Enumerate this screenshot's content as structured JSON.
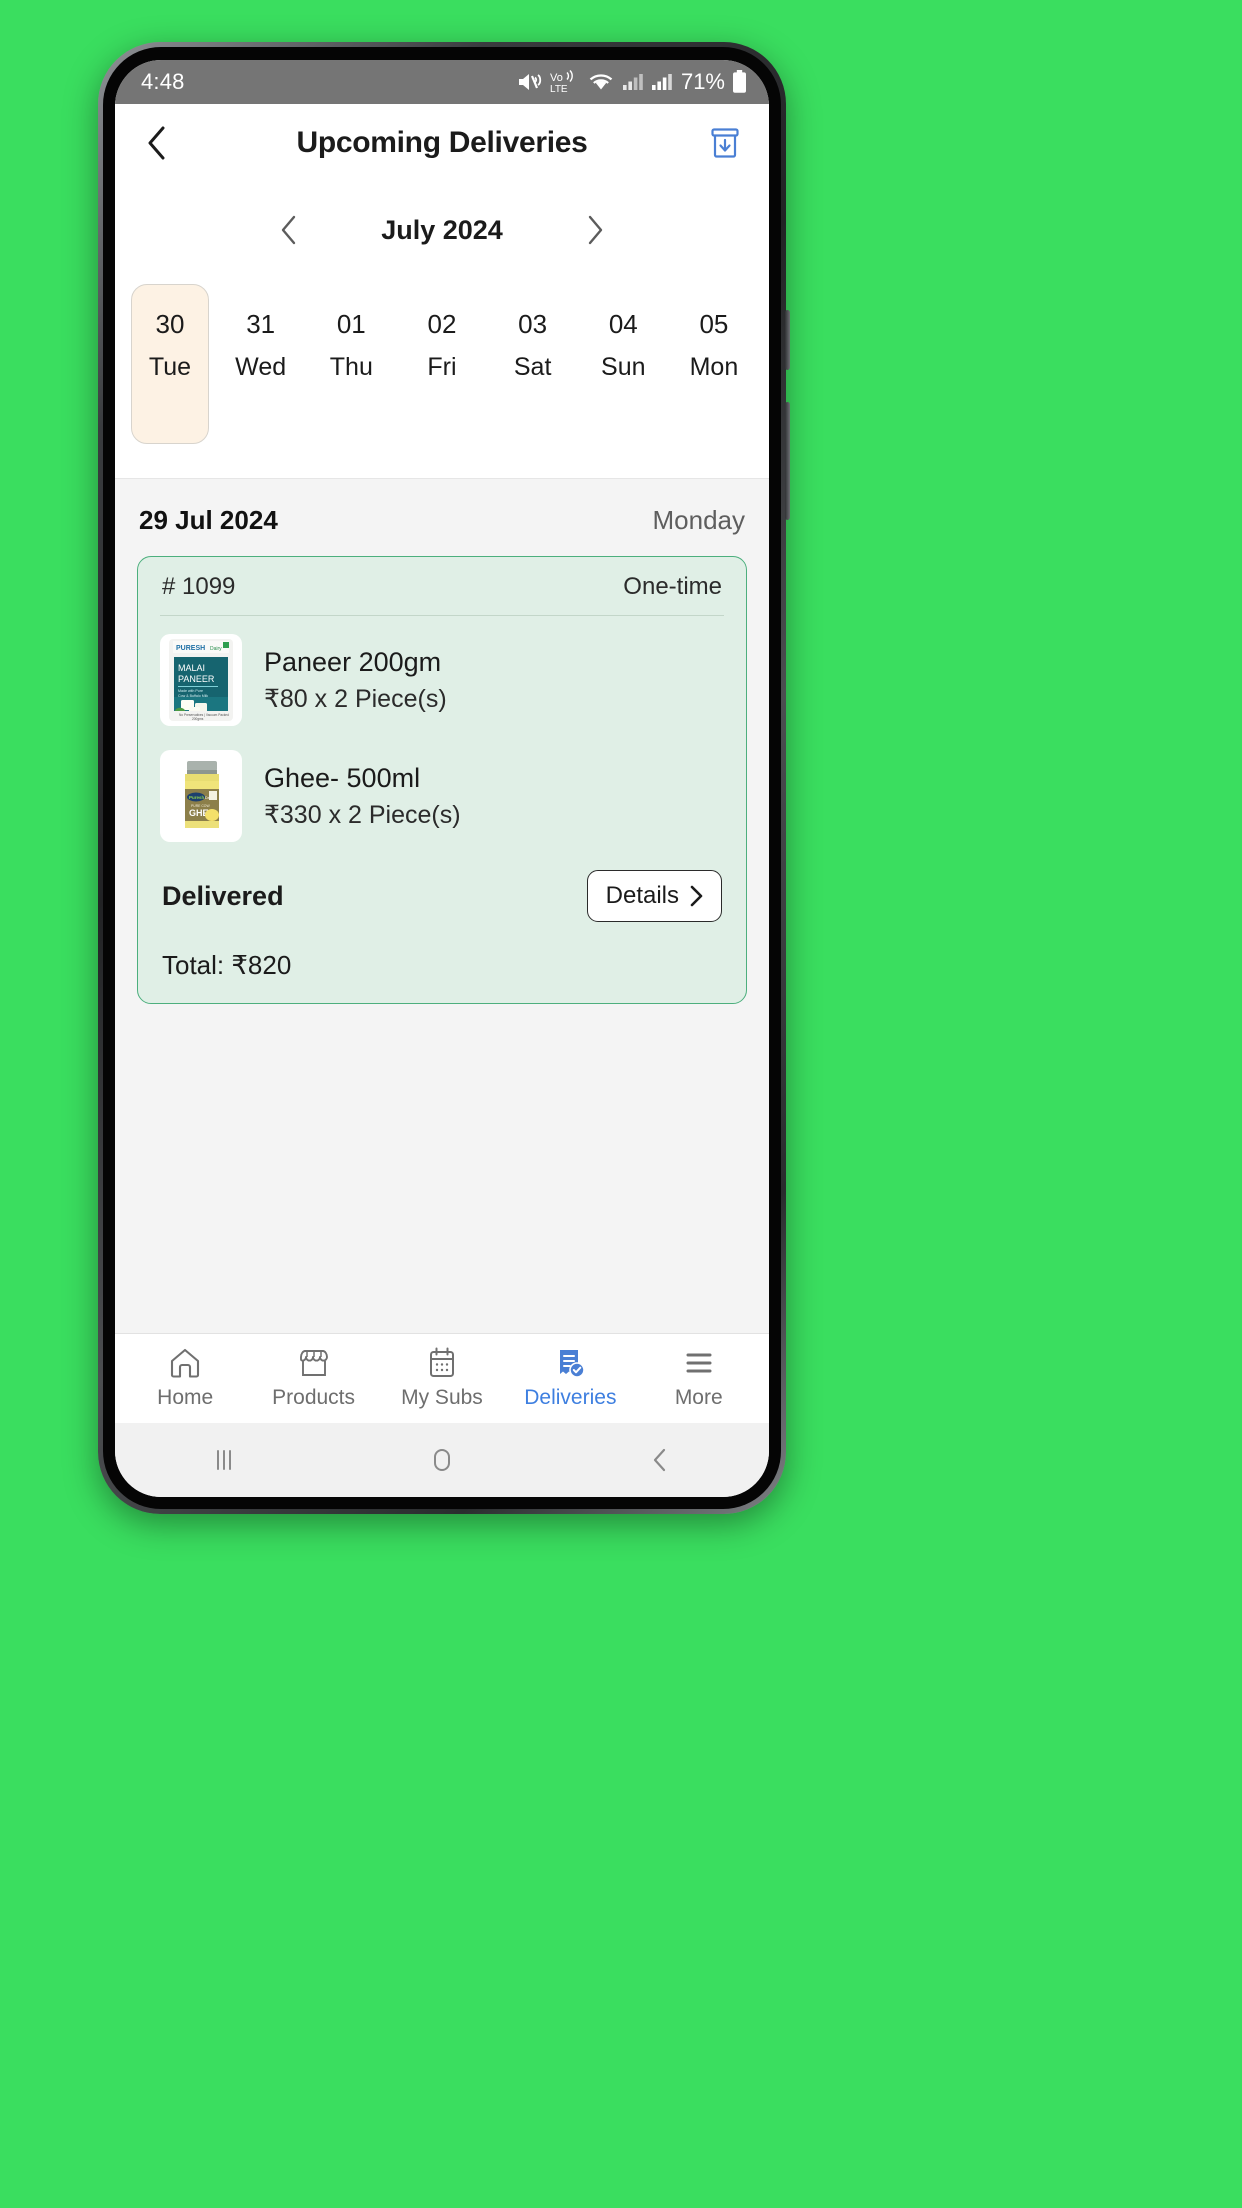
{
  "status_bar": {
    "time": "4:48",
    "battery_percent": "71%",
    "icons": [
      "mute-icon",
      "volte-icon",
      "wifi-icon",
      "signal-sim1-icon",
      "signal-sim2-icon",
      "battery-icon"
    ]
  },
  "header": {
    "title": "Upcoming Deliveries",
    "back_icon": "chevron-left-icon",
    "archive_icon": "archive-download-icon"
  },
  "month_selector": {
    "prev_icon": "chevron-left-icon",
    "label": "July 2024",
    "next_icon": "chevron-right-icon"
  },
  "date_strip": [
    {
      "day": "30",
      "dow": "Tue",
      "selected": true
    },
    {
      "day": "31",
      "dow": "Wed",
      "selected": false
    },
    {
      "day": "01",
      "dow": "Thu",
      "selected": false
    },
    {
      "day": "02",
      "dow": "Fri",
      "selected": false
    },
    {
      "day": "03",
      "dow": "Sat",
      "selected": false
    },
    {
      "day": "04",
      "dow": "Sun",
      "selected": false
    },
    {
      "day": "05",
      "dow": "Mon",
      "selected": false
    }
  ],
  "day_header": {
    "date": "29 Jul 2024",
    "weekday": "Monday"
  },
  "order": {
    "id": "# 1099",
    "type": "One-time",
    "items": [
      {
        "name": "Paneer 200gm",
        "price": "₹80 x 2 Piece(s)",
        "image": "paneer-packet-image"
      },
      {
        "name": "Ghee- 500ml",
        "price": "₹330 x 2 Piece(s)",
        "image": "ghee-jar-image"
      }
    ],
    "status": "Delivered",
    "details_label": "Details",
    "details_icon": "chevron-right-icon",
    "total": "Total: ₹820"
  },
  "bottom_nav": [
    {
      "label": "Home",
      "icon": "home-icon",
      "active": false
    },
    {
      "label": "Products",
      "icon": "store-icon",
      "active": false
    },
    {
      "label": "My Subs",
      "icon": "calendar-icon",
      "active": false
    },
    {
      "label": "Deliveries",
      "icon": "receipt-check-icon",
      "active": true
    },
    {
      "label": "More",
      "icon": "hamburger-menu-icon",
      "active": false
    }
  ],
  "system_nav": [
    {
      "icon": "recents-icon"
    },
    {
      "icon": "home-circle-icon"
    },
    {
      "icon": "back-chevron-icon"
    }
  ],
  "colors": {
    "background": "#3ade5f",
    "accent_blue": "#3e7fe0",
    "card_green_bg": "#e0efe6",
    "card_green_border": "#4caf7d",
    "selected_date_bg": "#fdf2e4"
  }
}
